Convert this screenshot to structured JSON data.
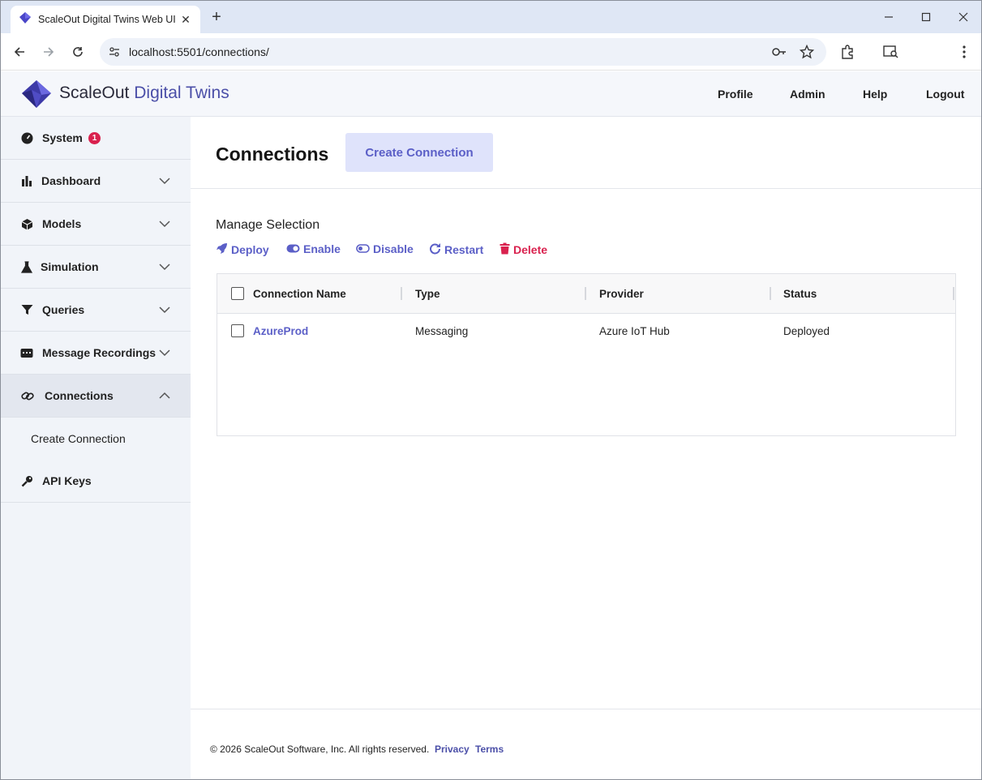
{
  "browser": {
    "tab_title": "ScaleOut Digital Twins Web UI",
    "url": "localhost:5501/connections/"
  },
  "header": {
    "brand_part1": "ScaleOut",
    "brand_part2": "Digital Twins",
    "nav": [
      "Profile",
      "Admin",
      "Help",
      "Logout"
    ]
  },
  "sidebar": {
    "items": [
      {
        "label": "System",
        "icon": "gauge-icon",
        "badge": "1"
      },
      {
        "label": "Dashboard",
        "icon": "bar-chart-icon"
      },
      {
        "label": "Models",
        "icon": "cube-icon"
      },
      {
        "label": "Simulation",
        "icon": "flask-icon"
      },
      {
        "label": "Queries",
        "icon": "filter-icon"
      },
      {
        "label": "Message Recordings",
        "icon": "message-icon"
      },
      {
        "label": "Connections",
        "icon": "link-icon"
      },
      {
        "label": "API Keys",
        "icon": "key-icon"
      }
    ],
    "sub_item": "Create Connection"
  },
  "main": {
    "title": "Connections",
    "create_button": "Create Connection",
    "manage_label": "Manage Selection",
    "actions": [
      "Deploy",
      "Enable",
      "Disable",
      "Restart",
      "Delete"
    ],
    "table": {
      "columns": [
        "Connection Name",
        "Type",
        "Provider",
        "Status"
      ],
      "rows": [
        {
          "name": "AzureProd",
          "type": "Messaging",
          "provider": "Azure IoT Hub",
          "status": "Deployed"
        }
      ]
    }
  },
  "footer": {
    "copyright": "© 2026 ScaleOut Software, Inc. All rights reserved.",
    "privacy": "Privacy",
    "terms": "Terms"
  },
  "colors": {
    "accent": "#5b5fc7",
    "danger": "#d9214e",
    "sidebar_bg": "#f1f4f9"
  }
}
